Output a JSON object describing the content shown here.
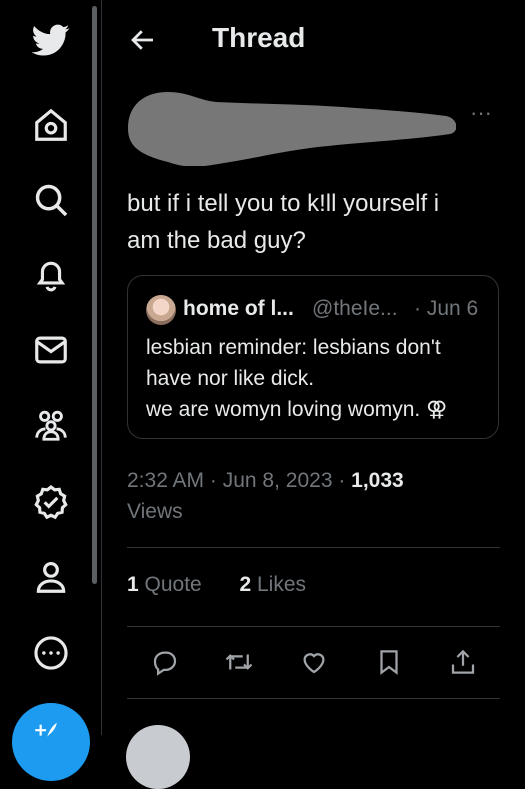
{
  "header": {
    "title": "Thread"
  },
  "tweet": {
    "text_line1": "but if i tell you to k!ll yourself i",
    "text_line2": "am the bad guy?",
    "more_label": "···"
  },
  "quote": {
    "name": "home of l...",
    "handle": "@theIe...",
    "date": "· Jun 6",
    "line1": "lesbian reminder: lesbians don't",
    "line2": "have nor like dick.",
    "line3": "we are womyn loving womyn. ⚢"
  },
  "meta": {
    "time": "2:32 AM",
    "dot1": " · ",
    "date": "Jun 8, 2023",
    "dot2": " · ",
    "views_count": "1,033",
    "views_label": "Views"
  },
  "stats": {
    "quotes_count": "1",
    "quotes_label": "Quote",
    "likes_count": "2",
    "likes_label": "Likes"
  },
  "colors": {
    "accent": "#1d9bf0",
    "background": "#000000",
    "muted": "#71767b",
    "divider": "#2f3336"
  },
  "icons": [
    "twitter-bird",
    "home",
    "search",
    "bell",
    "mail",
    "communities",
    "verified",
    "profile",
    "more-circle",
    "compose",
    "back-arrow",
    "reply",
    "retweet",
    "like",
    "bookmark",
    "share"
  ]
}
